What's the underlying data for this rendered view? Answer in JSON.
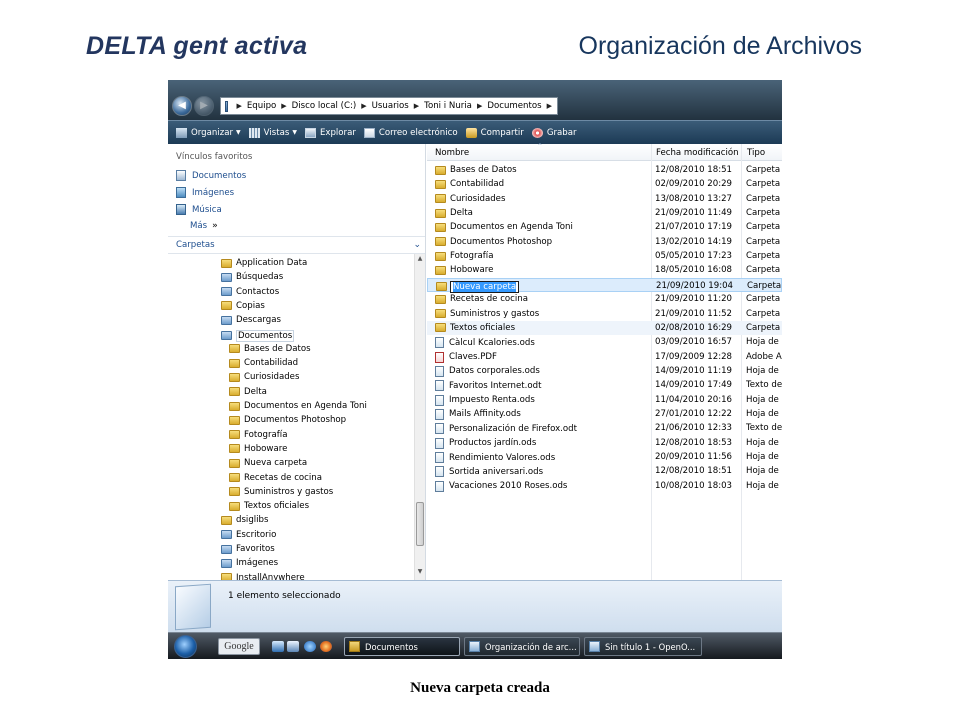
{
  "slide": {
    "brand": "DELTA gent activa",
    "title": "Organización de Archivos",
    "caption": "Nueva carpeta creada"
  },
  "address": {
    "breadcrumbs": [
      "Equipo",
      "Disco local (C:)",
      "Usuarios",
      "Toni i Nuria",
      "Documentos"
    ]
  },
  "toolbar": {
    "organize": "Organizar",
    "views": "Vistas",
    "explore": "Explorar",
    "email": "Correo electrónico",
    "share": "Compartir",
    "burn": "Grabar"
  },
  "sidebar": {
    "favorites_title": "Vínculos favoritos",
    "favorites": [
      "Documentos",
      "Imágenes",
      "Música"
    ],
    "more": "Más",
    "folders_title": "Carpetas",
    "tree": [
      {
        "label": "Application Data",
        "level": 1,
        "icon": "folder"
      },
      {
        "label": "Búsquedas",
        "level": 1,
        "icon": "folder-blue"
      },
      {
        "label": "Contactos",
        "level": 1,
        "icon": "folder-blue"
      },
      {
        "label": "Copias",
        "level": 1,
        "icon": "folder"
      },
      {
        "label": "Descargas",
        "level": 1,
        "icon": "folder-blue"
      },
      {
        "label": "Documentos",
        "level": 1,
        "icon": "folder-blue"
      },
      {
        "label": "Bases de Datos",
        "level": 2,
        "icon": "folder"
      },
      {
        "label": "Contabilidad",
        "level": 2,
        "icon": "folder"
      },
      {
        "label": "Curiosidades",
        "level": 2,
        "icon": "folder"
      },
      {
        "label": "Delta",
        "level": 2,
        "icon": "folder"
      },
      {
        "label": "Documentos en Agenda Toni",
        "level": 2,
        "icon": "folder"
      },
      {
        "label": "Documentos Photoshop",
        "level": 2,
        "icon": "folder"
      },
      {
        "label": "Fotografía",
        "level": 2,
        "icon": "folder"
      },
      {
        "label": "Hoboware",
        "level": 2,
        "icon": "folder"
      },
      {
        "label": "Nueva carpeta",
        "level": 2,
        "icon": "folder"
      },
      {
        "label": "Recetas de cocina",
        "level": 2,
        "icon": "folder"
      },
      {
        "label": "Suministros y gastos",
        "level": 2,
        "icon": "folder"
      },
      {
        "label": "Textos oficiales",
        "level": 2,
        "icon": "folder"
      },
      {
        "label": "dsiglibs",
        "level": 1,
        "icon": "folder"
      },
      {
        "label": "Escritorio",
        "level": 1,
        "icon": "folder-blue"
      },
      {
        "label": "Favoritos",
        "level": 1,
        "icon": "folder-blue"
      },
      {
        "label": "Imágenes",
        "level": 1,
        "icon": "folder-blue"
      },
      {
        "label": "InstallAnywhere",
        "level": 1,
        "icon": "folder"
      }
    ]
  },
  "list": {
    "columns": {
      "name": "Nombre",
      "date": "Fecha modificación",
      "type": "Tipo"
    },
    "rows": [
      {
        "name": "Bases de Datos",
        "date": "12/08/2010 18:51",
        "type": "Carpeta d",
        "icon": "folder"
      },
      {
        "name": "Contabilidad",
        "date": "02/09/2010 20:29",
        "type": "Carpeta d",
        "icon": "folder"
      },
      {
        "name": "Curiosidades",
        "date": "13/08/2010 13:27",
        "type": "Carpeta d",
        "icon": "folder"
      },
      {
        "name": "Delta",
        "date": "21/09/2010 11:49",
        "type": "Carpeta d",
        "icon": "folder"
      },
      {
        "name": "Documentos en Agenda Toni",
        "date": "21/07/2010 17:19",
        "type": "Carpeta d",
        "icon": "folder"
      },
      {
        "name": "Documentos Photoshop",
        "date": "13/02/2010 14:19",
        "type": "Carpeta d",
        "icon": "folder"
      },
      {
        "name": "Fotografía",
        "date": "05/05/2010 17:23",
        "type": "Carpeta d",
        "icon": "folder"
      },
      {
        "name": "Hoboware",
        "date": "18/05/2010 16:08",
        "type": "Carpeta d",
        "icon": "folder"
      },
      {
        "name": "Nueva carpeta",
        "date": "21/09/2010 19:04",
        "type": "Carpeta d",
        "icon": "folder",
        "renaming": true
      },
      {
        "name": "Recetas de cocina",
        "date": "21/09/2010 11:20",
        "type": "Carpeta d",
        "icon": "folder"
      },
      {
        "name": "Suministros y gastos",
        "date": "21/09/2010 11:52",
        "type": "Carpeta d",
        "icon": "folder"
      },
      {
        "name": "Textos oficiales",
        "date": "02/08/2010 16:29",
        "type": "Carpeta d",
        "icon": "folder",
        "stripe": true
      },
      {
        "name": "Càlcul Kcalories.ods",
        "date": "03/09/2010 16:57",
        "type": "Hoja de c",
        "icon": "file"
      },
      {
        "name": "Claves.PDF",
        "date": "17/09/2009 12:28",
        "type": "Adobe A",
        "icon": "pdf"
      },
      {
        "name": "Datos corporales.ods",
        "date": "14/09/2010 11:19",
        "type": "Hoja de c",
        "icon": "file"
      },
      {
        "name": "Favoritos Internet.odt",
        "date": "14/09/2010 17:49",
        "type": "Texto de",
        "icon": "file"
      },
      {
        "name": "Impuesto Renta.ods",
        "date": "11/04/2010 20:16",
        "type": "Hoja de c",
        "icon": "file"
      },
      {
        "name": "Mails Affinity.ods",
        "date": "27/01/2010 12:22",
        "type": "Hoja de c",
        "icon": "file"
      },
      {
        "name": "Personalización de Firefox.odt",
        "date": "21/06/2010 12:33",
        "type": "Texto de",
        "icon": "file"
      },
      {
        "name": "Productos jardín.ods",
        "date": "12/08/2010 18:53",
        "type": "Hoja de c",
        "icon": "file"
      },
      {
        "name": "Rendimiento Valores.ods",
        "date": "20/09/2010 11:56",
        "type": "Hoja de c",
        "icon": "file"
      },
      {
        "name": "Sortida aniversari.ods",
        "date": "12/08/2010 18:51",
        "type": "Hoja de c",
        "icon": "file"
      },
      {
        "name": "Vacaciones 2010 Roses.ods",
        "date": "10/08/2010 18:03",
        "type": "Hoja de c",
        "icon": "file"
      }
    ]
  },
  "status": {
    "text": "1 elemento seleccionado"
  },
  "taskbar": {
    "search": "Google",
    "tasks": [
      "Documentos",
      "Organización de arc...",
      "Sin título 1 - OpenO..."
    ]
  },
  "colors": {
    "link_blue": "#1e4e8e",
    "selection": "#dcecfc",
    "brand": "#23365f"
  }
}
